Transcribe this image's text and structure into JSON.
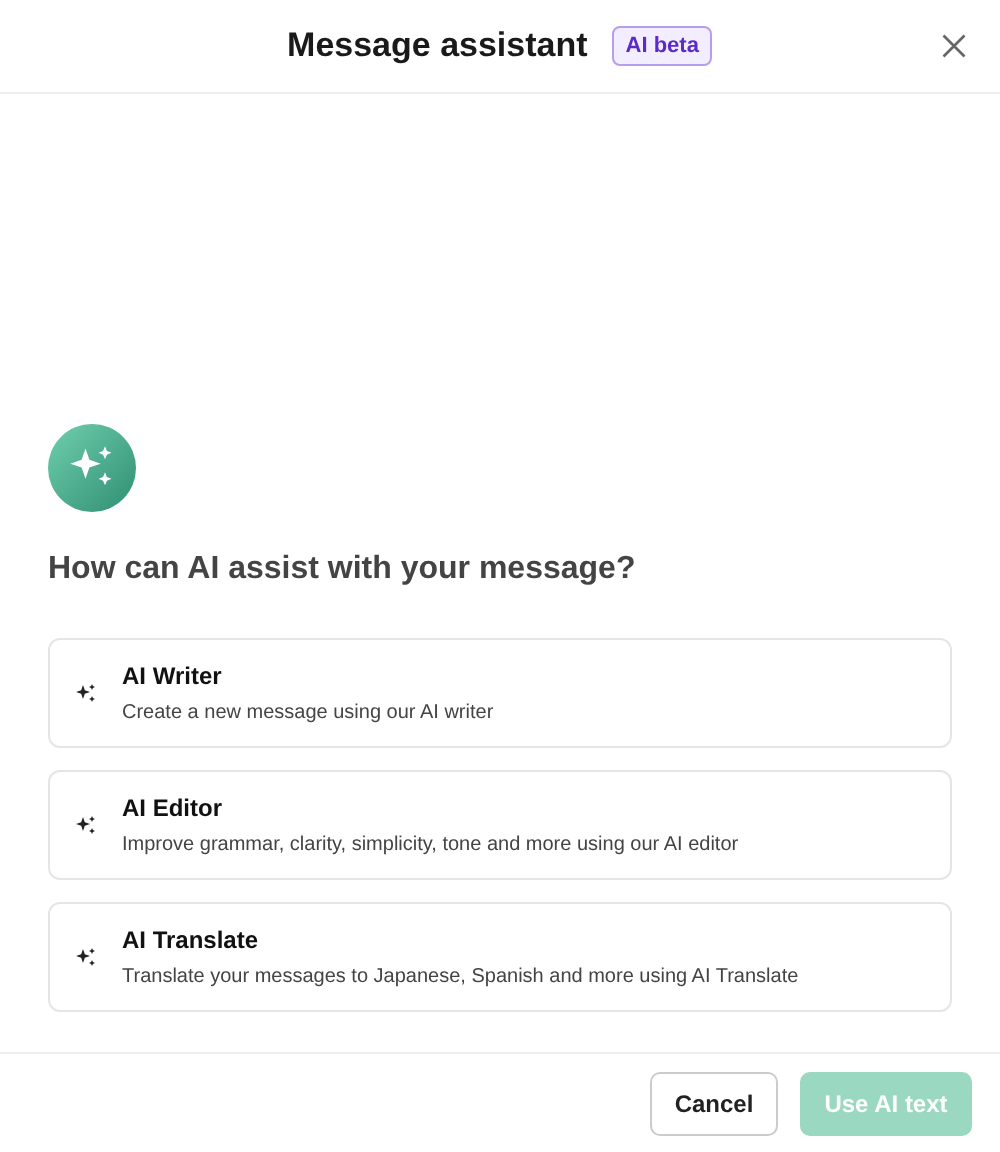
{
  "dialog": {
    "title": "Message assistant",
    "badge": "AI beta"
  },
  "prompt": "How can AI assist with your message?",
  "options": [
    {
      "title": "AI Writer",
      "description": "Create a new message using our AI writer"
    },
    {
      "title": "AI Editor",
      "description": "Improve grammar, clarity, simplicity, tone and more using our AI editor"
    },
    {
      "title": "AI Translate",
      "description": "Translate your messages to Japanese, Spanish and more using AI Translate"
    }
  ],
  "buttons": [
    {
      "label": "Cancel",
      "kind": "secondary",
      "disabled": false
    },
    {
      "label": "Use AI text",
      "kind": "primary",
      "disabled": true
    }
  ]
}
